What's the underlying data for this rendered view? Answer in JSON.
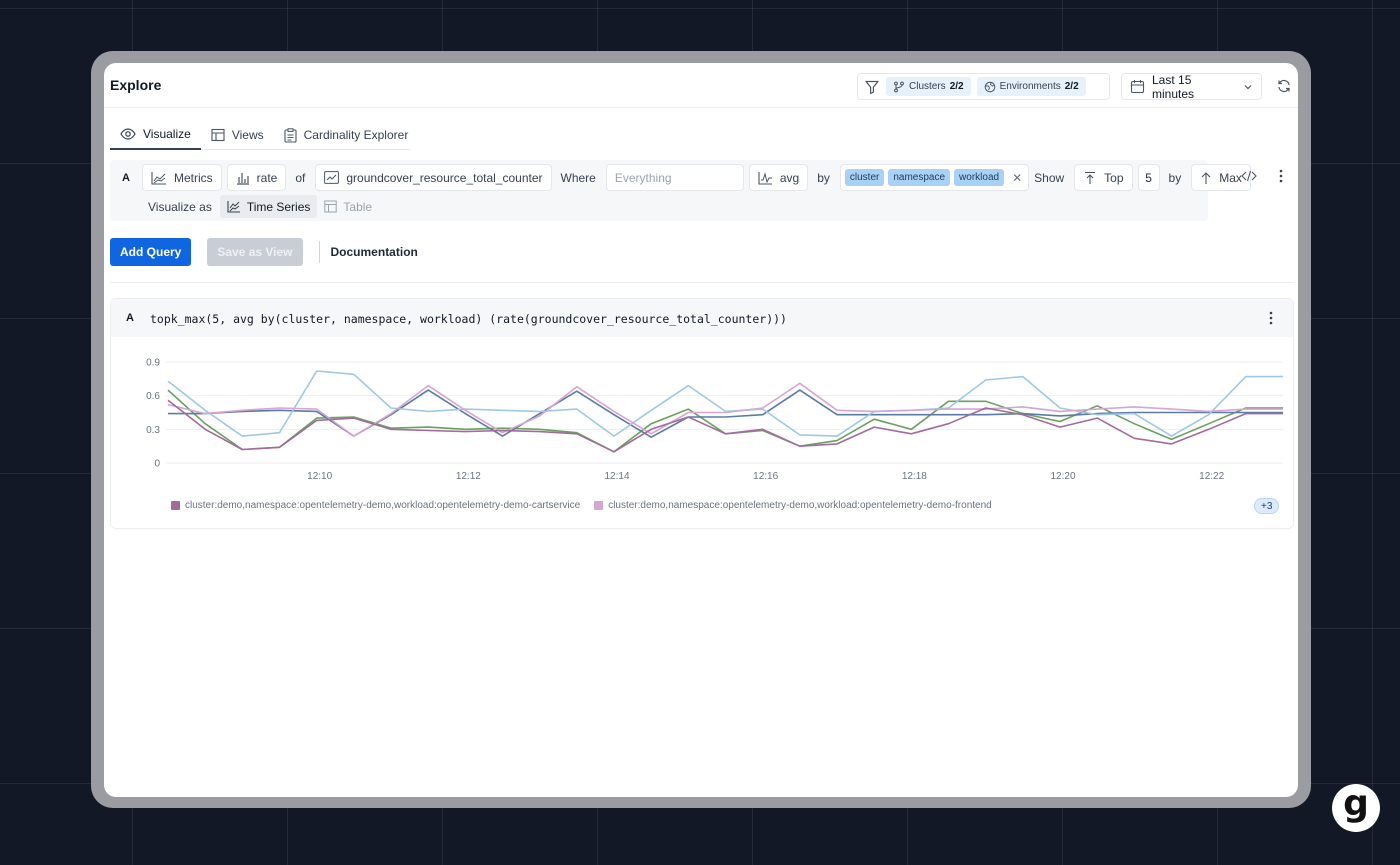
{
  "header": {
    "title": "Explore",
    "filters": [
      {
        "label": "Clusters",
        "value": "2/2"
      },
      {
        "label": "Environments",
        "value": "2/2"
      }
    ],
    "time_range": "Last 15 minutes"
  },
  "tabs": [
    {
      "label": "Visualize",
      "icon": "eye-icon",
      "active": true
    },
    {
      "label": "Views",
      "icon": "table-icon",
      "active": false
    },
    {
      "label": "Cardinality Explorer",
      "icon": "clipboard-icon",
      "active": false
    }
  ],
  "query_builder": {
    "letter": "A",
    "source": "Metrics",
    "function": "rate",
    "of_kw": "of",
    "metric": "groundcover_resource_total_counter",
    "where_kw": "Where",
    "where_placeholder": "Everything",
    "aggregation": "avg",
    "by_kw": "by",
    "group_by": [
      "cluster",
      "namespace",
      "workload"
    ],
    "show_kw": "Show",
    "top_label": "Top",
    "top_n": "5",
    "by_kw2": "by",
    "rank_by": "Max",
    "visualize_as_label": "Visualize as",
    "viz_options": [
      "Time Series",
      "Table"
    ]
  },
  "actions": {
    "add_query": "Add Query",
    "save_view": "Save as View",
    "documentation": "Documentation"
  },
  "result": {
    "letter": "A",
    "query": "topk_max(5, avg by(cluster, namespace, workload) (rate(groundcover_resource_total_counter)))",
    "legend": [
      {
        "label": "cluster:demo,namespace:opentelemetry-demo,workload:opentelemetry-demo-cartservice",
        "color": "#a26b9e"
      },
      {
        "label": "cluster:demo,namespace:opentelemetry-demo,workload:opentelemetry-demo-frontend",
        "color": "#d4a6d0"
      }
    ],
    "legend_more": "+3"
  },
  "chart_data": {
    "type": "line",
    "x": [
      "12:09",
      "12:09:30",
      "12:10",
      "12:10:30",
      "12:11",
      "12:11:30",
      "12:12",
      "12:12:30",
      "12:13",
      "12:13:30",
      "12:14",
      "12:14:30",
      "12:15",
      "12:15:30",
      "12:16",
      "12:16:30",
      "12:17",
      "12:17:30",
      "12:18",
      "12:18:30",
      "12:19",
      "12:19:30",
      "12:20",
      "12:20:30",
      "12:21",
      "12:21:30",
      "12:22",
      "12:22:30",
      "12:23"
    ],
    "x_ticks": [
      "12:10",
      "12:12",
      "12:14",
      "12:16",
      "12:18",
      "12:20",
      "12:22"
    ],
    "ylim": [
      0,
      0.9
    ],
    "y_ticks": [
      "0",
      "0.3",
      "0.6",
      "0.9"
    ],
    "series": [
      {
        "name": "cluster:demo,namespace:opentelemetry-demo,workload:opentelemetry-demo-cartservice",
        "color": "#a26b9e",
        "values": [
          0.56,
          0.3,
          0.12,
          0.14,
          0.38,
          0.4,
          0.3,
          0.29,
          0.28,
          0.29,
          0.28,
          0.26,
          0.1,
          0.3,
          0.41,
          0.26,
          0.3,
          0.15,
          0.17,
          0.32,
          0.26,
          0.35,
          0.49,
          0.43,
          0.32,
          0.4,
          0.22,
          0.17,
          0.3,
          0.44,
          0.44
        ]
      },
      {
        "name": "cluster:demo,namespace:opentelemetry-demo,workload:opentelemetry-demo-frontend",
        "color": "#d4a6d0",
        "values": [
          0.52,
          0.44,
          0.47,
          0.49,
          0.48,
          0.24,
          0.44,
          0.69,
          0.47,
          0.27,
          0.42,
          0.68,
          0.46,
          0.26,
          0.45,
          0.45,
          0.49,
          0.71,
          0.47,
          0.46,
          0.47,
          0.48,
          0.48,
          0.5,
          0.46,
          0.48,
          0.5,
          0.48,
          0.46,
          0.48,
          0.48
        ]
      },
      {
        "color": "#9ec8e6",
        "values": [
          0.73,
          0.47,
          0.24,
          0.27,
          0.82,
          0.79,
          0.49,
          0.46,
          0.48,
          0.47,
          0.46,
          0.48,
          0.24,
          0.47,
          0.69,
          0.46,
          0.48,
          0.25,
          0.24,
          0.46,
          0.47,
          0.49,
          0.74,
          0.77,
          0.49,
          0.43,
          0.44,
          0.24,
          0.43,
          0.77,
          0.77
        ]
      },
      {
        "color": "#5b7aa5",
        "values": [
          0.44,
          0.44,
          0.46,
          0.47,
          0.46,
          0.24,
          0.43,
          0.65,
          0.44,
          0.24,
          0.44,
          0.64,
          0.43,
          0.23,
          0.41,
          0.41,
          0.43,
          0.65,
          0.43,
          0.43,
          0.43,
          0.43,
          0.43,
          0.44,
          0.42,
          0.44,
          0.45,
          0.45,
          0.45,
          0.45,
          0.45
        ]
      },
      {
        "color": "#6aa15d",
        "values": [
          0.65,
          0.35,
          0.12,
          0.14,
          0.4,
          0.41,
          0.31,
          0.32,
          0.3,
          0.31,
          0.3,
          0.27,
          0.1,
          0.35,
          0.48,
          0.26,
          0.29,
          0.15,
          0.2,
          0.39,
          0.3,
          0.55,
          0.55,
          0.44,
          0.37,
          0.51,
          0.35,
          0.21,
          0.35,
          0.49,
          0.49
        ]
      }
    ]
  }
}
